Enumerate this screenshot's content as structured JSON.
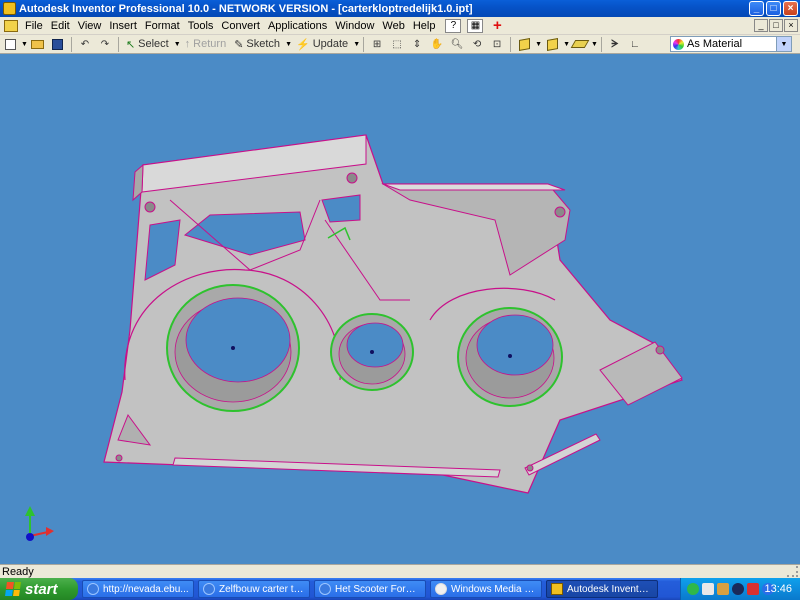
{
  "window": {
    "title": "Autodesk Inventor Professional 10.0 - NETWORK VERSION - [carterkloptredelijk1.0.ipt]",
    "buttons": [
      "_",
      "□",
      "×"
    ]
  },
  "menu": {
    "items": [
      "File",
      "Edit",
      "View",
      "Insert",
      "Format",
      "Tools",
      "Convert",
      "Applications",
      "Window",
      "Web",
      "Help"
    ],
    "help_icon": "?",
    "plus_icon": "+",
    "mdi_buttons": [
      "_",
      "□",
      "×"
    ]
  },
  "toolbar": {
    "select_label": "Select",
    "return_label": "Return",
    "sketch_label": "Sketch",
    "update_label": "Update",
    "material_value": "As Material"
  },
  "viewport": {
    "background": "#4b8bc6",
    "part_color": "#c2c2c2",
    "edge_color": "#c8108a",
    "highlight_color": "#2ec22e",
    "triad_labels": [
      "Y",
      "X",
      "Z"
    ]
  },
  "status": {
    "text": "Ready"
  },
  "taskbar": {
    "start_label": "start",
    "tasks": [
      {
        "label": "http://nevada.ebu...",
        "icon": "ie-icon",
        "active": false
      },
      {
        "label": "Zelfbouw carter to...",
        "icon": "ie-icon",
        "active": false
      },
      {
        "label": "Het Scooter Forum...",
        "icon": "ie-icon",
        "active": false
      },
      {
        "label": "Windows Media Pla...",
        "icon": "media-player-icon",
        "active": false
      },
      {
        "label": "Autodesk Inventor...",
        "icon": "inventor-icon",
        "active": true
      }
    ],
    "clock": "13:46"
  }
}
